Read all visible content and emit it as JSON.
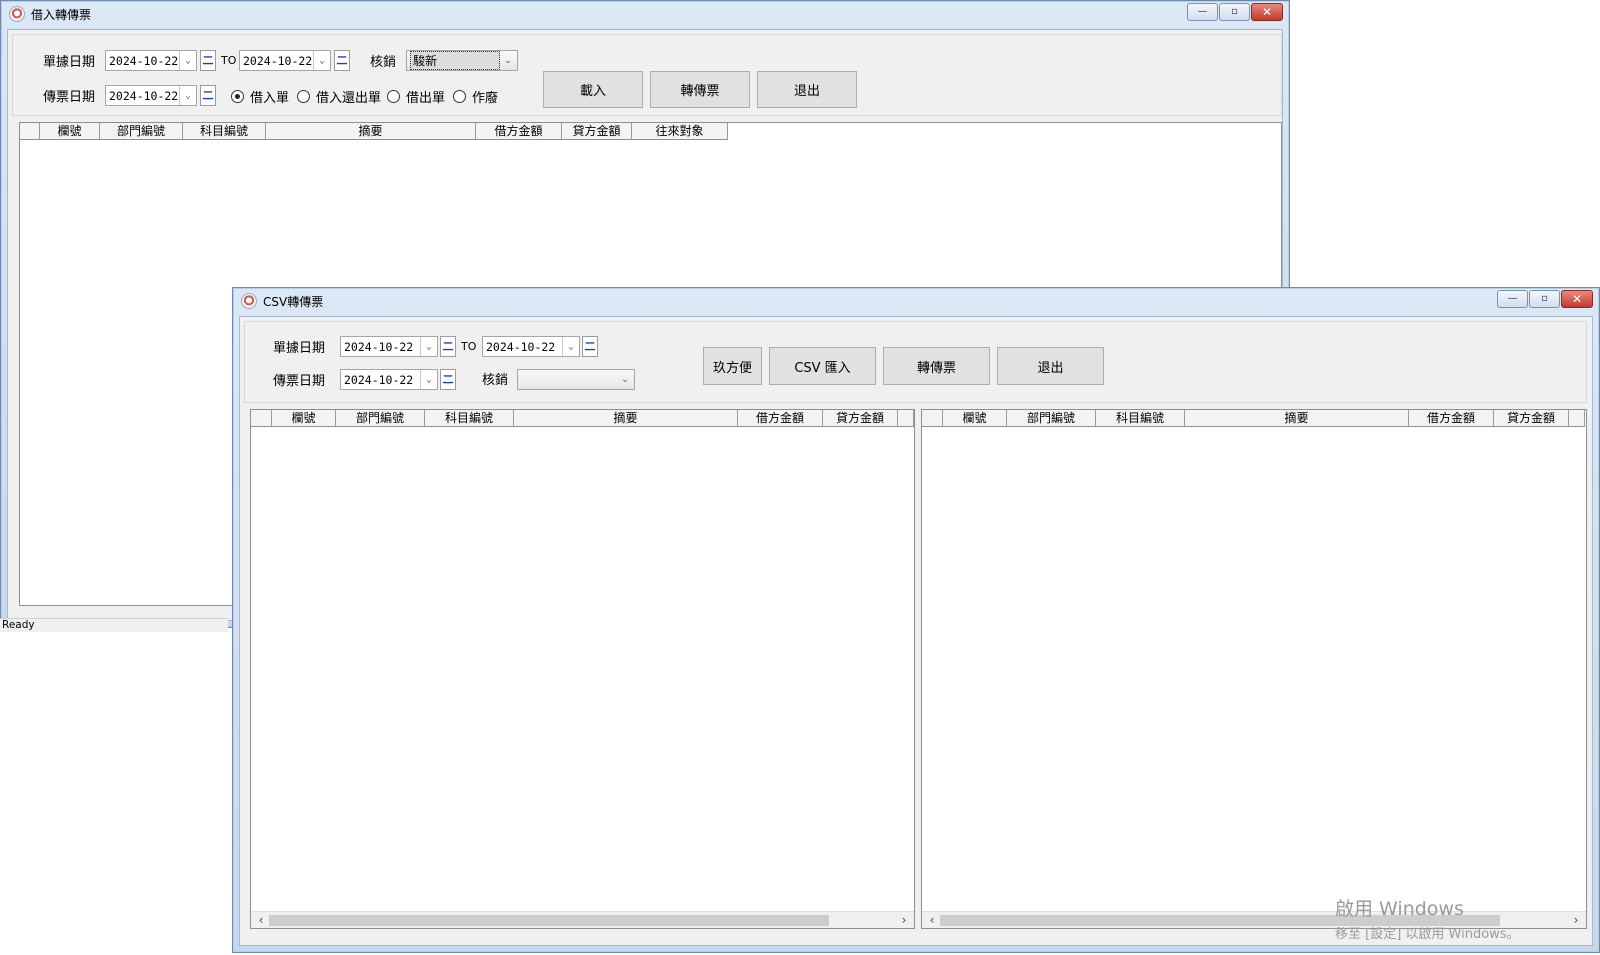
{
  "win1": {
    "title": "借入轉傳票",
    "doc_date_label": "單據日期",
    "doc_date_from": "2024-10-22",
    "to_label": "TO",
    "doc_date_to": "2024-10-22",
    "writeoff_label": "核銷",
    "writeoff_value": "駿新",
    "voucher_date_label": "傳票日期",
    "voucher_date": "2024-10-22",
    "radios": [
      {
        "label": "借入單",
        "selected": true
      },
      {
        "label": "借入還出單",
        "selected": false
      },
      {
        "label": "借出單",
        "selected": false
      },
      {
        "label": "作廢",
        "selected": false
      }
    ],
    "buttons": {
      "load": "載入",
      "transfer": "轉傳票",
      "exit": "退出"
    },
    "columns": [
      "",
      "欄號",
      "部門編號",
      "科目編號",
      "摘要",
      "借方金額",
      "貸方金額",
      "往來對象"
    ]
  },
  "status_text": "Ready",
  "win2": {
    "title": "CSV轉傳票",
    "doc_date_label": "單據日期",
    "doc_date_from": "2024-10-22",
    "to_label": "TO",
    "doc_date_to": "2024-10-22",
    "voucher_date_label": "傳票日期",
    "voucher_date": "2024-10-22",
    "writeoff_label": "核銷",
    "writeoff_value": "",
    "buttons": {
      "convenient": "玖方便",
      "csv_import": "CSV 匯入",
      "transfer": "轉傳票",
      "exit": "退出"
    },
    "left_columns": [
      "",
      "欄號",
      "部門編號",
      "科目編號",
      "摘要",
      "借方金額",
      "貸方金額",
      ""
    ],
    "right_columns": [
      "",
      "欄號",
      "部門編號",
      "科目編號",
      "摘要",
      "借方金額",
      "貸方金額",
      ""
    ]
  },
  "calendar_glyph": "二",
  "window_controls": {
    "minimize": "—",
    "maximize": "▫",
    "close": "✕"
  },
  "watermark": {
    "line1": "啟用 Windows",
    "line2": "移至 [設定] 以啟用 Windows。"
  }
}
